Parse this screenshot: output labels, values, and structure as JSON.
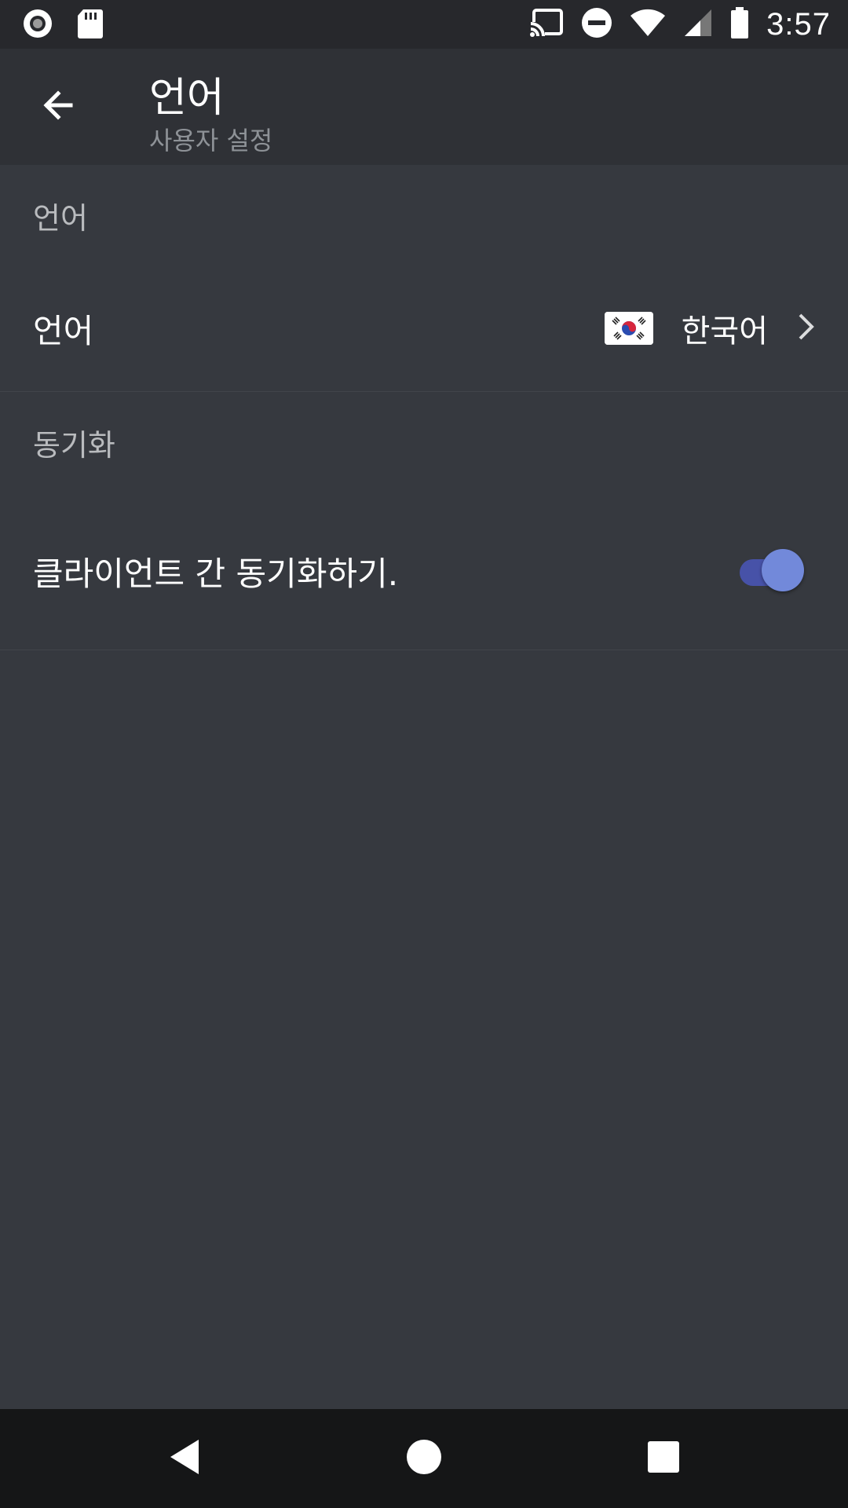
{
  "status_bar": {
    "time": "3:57",
    "icons": [
      "record-icon",
      "sd-card-icon",
      "cast-icon",
      "do-not-disturb-icon",
      "wifi-icon",
      "signal-icon",
      "battery-icon"
    ]
  },
  "app_bar": {
    "title": "언어",
    "subtitle": "사용자 설정",
    "back_icon": "arrow-left-icon"
  },
  "sections": {
    "language": {
      "header": "언어",
      "row_label": "언어",
      "value": "한국어",
      "flag_icon": "korea-flag-icon"
    },
    "sync": {
      "header": "동기화",
      "row_label": "클라이언트 간 동기화하기.",
      "toggle_on": true
    }
  },
  "nav_bar": {
    "icons": [
      "back-triangle-icon",
      "home-circle-icon",
      "recents-square-icon"
    ]
  },
  "colors": {
    "background": "#36393f",
    "app_bar": "#2f3136",
    "accent": "#7289da",
    "muted_text": "#8e9297"
  }
}
